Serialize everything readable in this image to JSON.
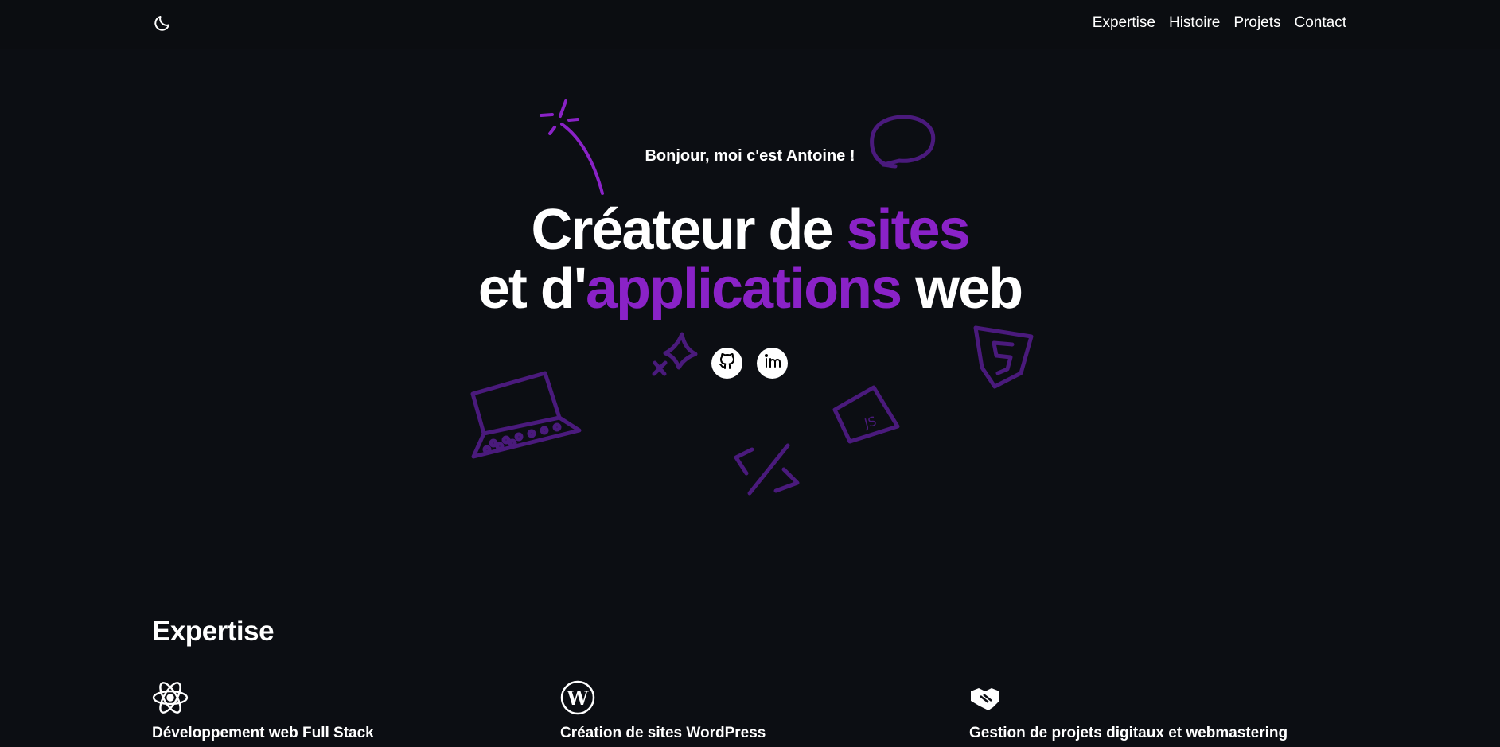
{
  "nav": {
    "theme_icon": "moon-icon",
    "links": [
      "Expertise",
      "Histoire",
      "Projets",
      "Contact"
    ]
  },
  "hero": {
    "greeting": "Bonjour, moi c'est Antoine !",
    "line1_a": "Créateur de ",
    "line1_accent": "sites",
    "line2_a": "et d'",
    "line2_accent": "applications",
    "line2_b": " web",
    "socials": [
      {
        "icon": "github-icon"
      },
      {
        "icon": "linkedin-icon"
      }
    ]
  },
  "expertise": {
    "title": "Expertise",
    "cards": [
      {
        "icon": "react-icon",
        "title": "Développement web Full Stack"
      },
      {
        "icon": "wordpress-icon",
        "title": "Création de sites WordPress"
      },
      {
        "icon": "handshake-icon",
        "title": "Gestion de projets digitaux et webmastering"
      }
    ]
  },
  "colors": {
    "background": "#0c0e13",
    "accent": "#8a22c7",
    "doodle": "#4a1a7c"
  }
}
